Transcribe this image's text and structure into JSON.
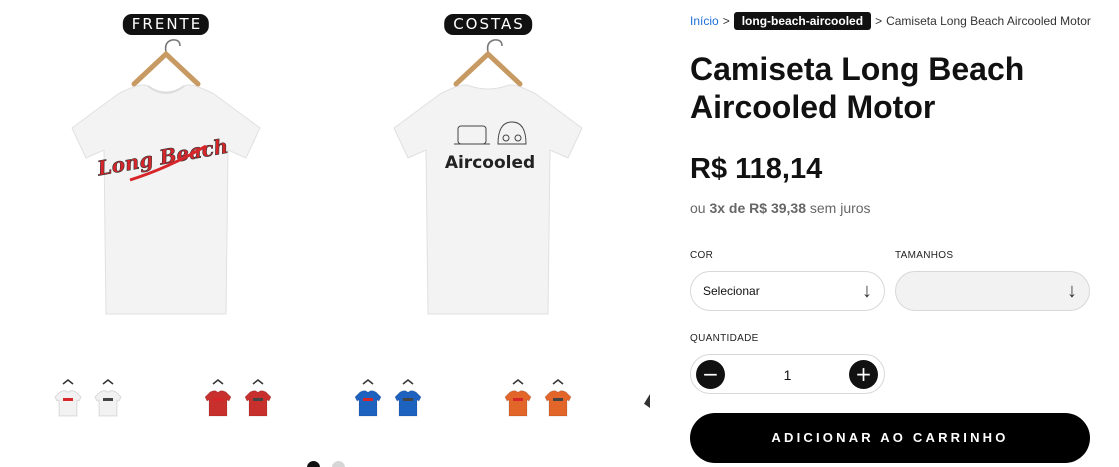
{
  "gallery": {
    "front_label": "FRENTE",
    "back_label": "COSTAS",
    "front_print": "Long Beach",
    "back_print": "Aircooled",
    "thumbnail_colors": [
      "#f2f2f2",
      "#c8302e",
      "#1e62c0",
      "#e2662a"
    ],
    "accent_print_color": "#d7262a"
  },
  "breadcrumb": {
    "home": "Início",
    "separator": ">",
    "collection": "long-beach-aircooled",
    "current": "Camiseta Long Beach Aircooled Motor"
  },
  "product": {
    "title": "Camiseta Long Beach Aircooled Motor",
    "price": "R$ 118,14",
    "installments_prefix": "ou",
    "installments_value": "3x de R$ 39,38",
    "installments_suffix": "sem juros"
  },
  "options": {
    "color_label": "COR",
    "color_value": "Selecionar",
    "size_label": "TAMANHOS",
    "size_value": ""
  },
  "quantity": {
    "label": "QUANTIDADE",
    "value": "1",
    "minus": "−",
    "plus": "+"
  },
  "cart": {
    "add_label": "ADICIONAR AO CARRINHO"
  }
}
